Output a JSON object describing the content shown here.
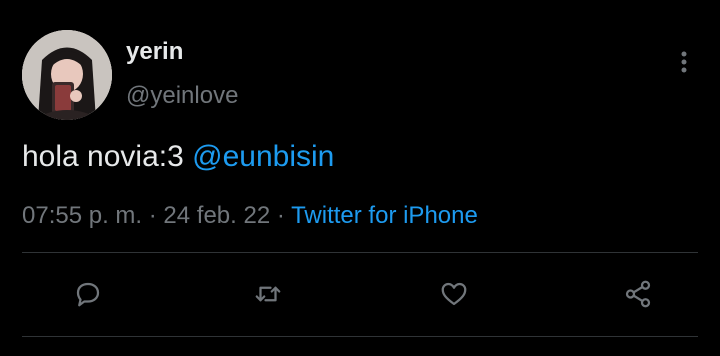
{
  "author": {
    "name": "yerin",
    "handle": "@yeinlove",
    "avatar": "avatar-photo"
  },
  "tweet": {
    "text": "hola novia:3",
    "mention": "@eunbisin"
  },
  "meta": {
    "time": "07:55 p. m.",
    "separator1": " · ",
    "date": "24 feb. 22",
    "separator2": " · ",
    "source": "Twitter for iPhone"
  },
  "actions": [
    {
      "icon": "reply-icon"
    },
    {
      "icon": "retweet-icon"
    },
    {
      "icon": "like-icon"
    },
    {
      "icon": "share-icon"
    }
  ],
  "colors": {
    "background": "#000000",
    "text": "#e7e9ea",
    "secondary": "#71767b",
    "accent": "#1d9bf0",
    "divider": "#2f3336"
  }
}
